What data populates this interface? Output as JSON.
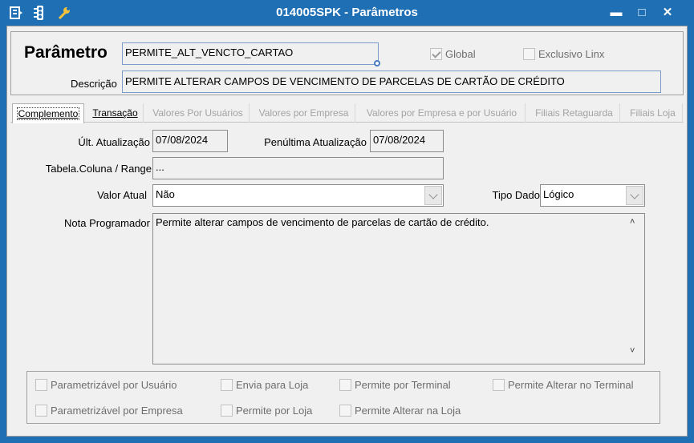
{
  "window": {
    "title": "014005SPK - Parâmetros",
    "icons": [
      "menu-icon",
      "traffic-light-icon",
      "wrench-icon"
    ],
    "controls": {
      "minimize": "▬",
      "maximize": "□",
      "close": "✕"
    }
  },
  "parameter": {
    "label": "Parâmetro",
    "value": "PERMITE_ALT_VENCTO_CARTAO",
    "global_label": "Global",
    "global_checked": true,
    "exclusivo_label": "Exclusivo Linx",
    "exclusivo_checked": false
  },
  "description": {
    "label": "Descrição",
    "value": "PERMITE ALTERAR CAMPOS DE VENCIMENTO DE PARCELAS DE CARTÃO DE CRÉDITO"
  },
  "tabs": [
    {
      "label": "Complemento",
      "active": true,
      "enabled": true
    },
    {
      "label": "Transação",
      "active": false,
      "enabled": true
    },
    {
      "label": "Valores Por Usuários",
      "active": false,
      "enabled": false
    },
    {
      "label": "Valores por Empresa",
      "active": false,
      "enabled": false
    },
    {
      "label": "Valores por Empresa e por Usuário",
      "active": false,
      "enabled": false
    },
    {
      "label": "Filiais Retaguarda",
      "active": false,
      "enabled": false
    },
    {
      "label": "Filiais Loja",
      "active": false,
      "enabled": false
    }
  ],
  "form": {
    "ultima_label": "Últ. Atualização",
    "ultima_value": "07/08/2024",
    "penultima_label": "Penúltima Atualização",
    "penultima_value": "07/08/2024",
    "tabela_label": "Tabela.Coluna / Range",
    "tabela_value": "...",
    "valor_label": "Valor Atual",
    "valor_value": "Não",
    "tipo_label": "Tipo Dado",
    "tipo_value": "Lógico",
    "nota_label": "Nota Programador",
    "nota_value": "Permite alterar campos de vencimento de parcelas de cartão de crédito.",
    "scroll_up": "˄",
    "scroll_down": "˅"
  },
  "options": {
    "parametrizavel_usuario": "Parametrizável por Usuário",
    "envia_loja": "Envia para Loja",
    "permite_terminal": "Permite por Terminal",
    "permite_alterar_terminal": "Permite Alterar no Terminal",
    "parametrizavel_empresa": "Parametrizável por Empresa",
    "permite_loja": "Permite por Loja",
    "permite_alterar_loja": "Permite Alterar na Loja"
  }
}
